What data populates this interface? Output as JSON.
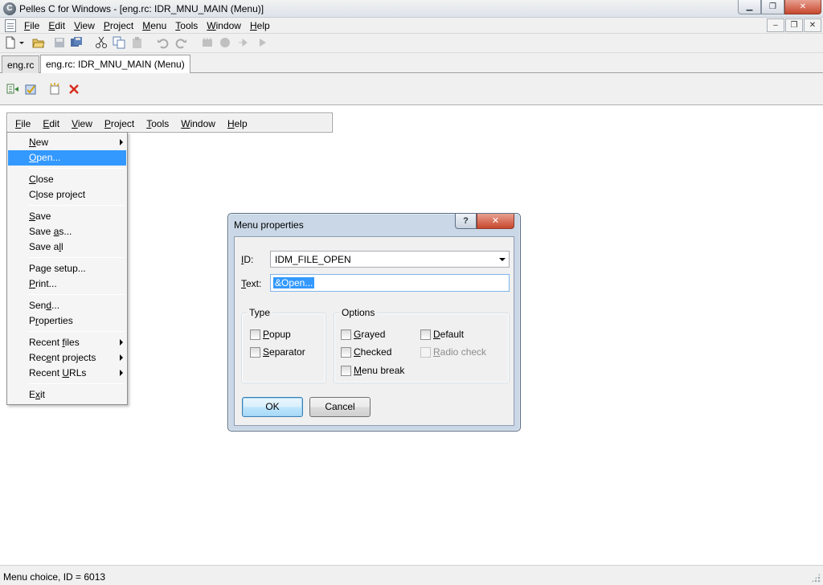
{
  "window": {
    "title": "Pelles C for Windows - [eng.rc: IDR_MNU_MAIN (Menu)]",
    "icon": "pelles-c-app-icon"
  },
  "main_menu": {
    "items": [
      {
        "pre": "",
        "u": "F",
        "post": "ile"
      },
      {
        "pre": "",
        "u": "E",
        "post": "dit"
      },
      {
        "pre": "",
        "u": "V",
        "post": "iew"
      },
      {
        "pre": "",
        "u": "P",
        "post": "roject"
      },
      {
        "pre": "",
        "u": "M",
        "post": "enu"
      },
      {
        "pre": "",
        "u": "T",
        "post": "ools"
      },
      {
        "pre": "",
        "u": "W",
        "post": "indow"
      },
      {
        "pre": "",
        "u": "H",
        "post": "elp"
      }
    ]
  },
  "toolbar": {
    "icons": [
      "new-file-icon",
      "dropdown-icon",
      "open-folder-icon",
      "save-icon",
      "save-all-icon",
      "cut-icon",
      "copy-icon",
      "paste-icon",
      "undo-icon",
      "redo-icon",
      "compile-icon",
      "build-icon",
      "debug-icon",
      "run-icon"
    ]
  },
  "tabs": [
    {
      "label": "eng.rc",
      "active": false
    },
    {
      "label": "eng.rc: IDR_MNU_MAIN (Menu)",
      "active": true
    }
  ],
  "editor_toolbar": {
    "icons": [
      "test-menu-icon",
      "check-menu-icon",
      "new-item-icon",
      "delete-icon"
    ]
  },
  "preview_menu": {
    "items": [
      {
        "pre": "",
        "u": "F",
        "post": "ile"
      },
      {
        "pre": "",
        "u": "E",
        "post": "dit"
      },
      {
        "pre": "",
        "u": "V",
        "post": "iew"
      },
      {
        "pre": "",
        "u": "P",
        "post": "roject"
      },
      {
        "pre": "",
        "u": "T",
        "post": "ools"
      },
      {
        "pre": "",
        "u": "W",
        "post": "indow"
      },
      {
        "pre": "",
        "u": "H",
        "post": "elp"
      }
    ]
  },
  "file_dropdown": {
    "items": [
      {
        "pre": "",
        "u": "N",
        "post": "ew",
        "submenu": true
      },
      {
        "pre": "",
        "u": "O",
        "post": "pen...",
        "selected": true
      },
      {
        "pre": "",
        "u": "C",
        "post": "lose"
      },
      {
        "pre": "C",
        "u": "l",
        "post": "ose project"
      },
      {
        "pre": "",
        "u": "S",
        "post": "ave"
      },
      {
        "pre": "Save ",
        "u": "a",
        "post": "s..."
      },
      {
        "pre": "Save a",
        "u": "l",
        "post": "l"
      },
      {
        "pre": "Pa",
        "u": "g",
        "post": "e setup..."
      },
      {
        "pre": "",
        "u": "P",
        "post": "rint..."
      },
      {
        "pre": "Sen",
        "u": "d",
        "post": "..."
      },
      {
        "pre": "P",
        "u": "r",
        "post": "operties"
      },
      {
        "pre": "Recent ",
        "u": "f",
        "post": "iles",
        "submenu": true
      },
      {
        "pre": "Rec",
        "u": "e",
        "post": "nt projects",
        "submenu": true
      },
      {
        "pre": "Recent ",
        "u": "U",
        "post": "RLs",
        "submenu": true
      },
      {
        "pre": "E",
        "u": "x",
        "post": "it"
      }
    ]
  },
  "dialog": {
    "title": "Menu properties",
    "help_label": "?",
    "close_label": "✕",
    "id_label_u": "I",
    "id_label_rest": "D:",
    "id_value": "IDM_FILE_OPEN",
    "text_label_u": "T",
    "text_label_rest": "ext:",
    "text_value": "&Open...",
    "type_group": "Type",
    "options_group": "Options",
    "checkboxes": {
      "popup": {
        "u": "P",
        "rest": "opup",
        "checked": false
      },
      "separator": {
        "u": "S",
        "rest": "eparator",
        "checked": false
      },
      "grayed": {
        "u": "G",
        "rest": "rayed",
        "checked": false
      },
      "checked": {
        "u": "C",
        "rest": "hecked",
        "checked": false
      },
      "menu_break": {
        "u": "M",
        "rest": "enu break",
        "checked": false
      },
      "default": {
        "u": "D",
        "rest": "efault",
        "checked": false
      },
      "radio_check": {
        "u": "R",
        "rest": "adio check",
        "checked": false,
        "disabled": true
      }
    },
    "ok_label": "OK",
    "cancel_label": "Cancel"
  },
  "status": {
    "text": "Menu choice, ID = 6013"
  }
}
